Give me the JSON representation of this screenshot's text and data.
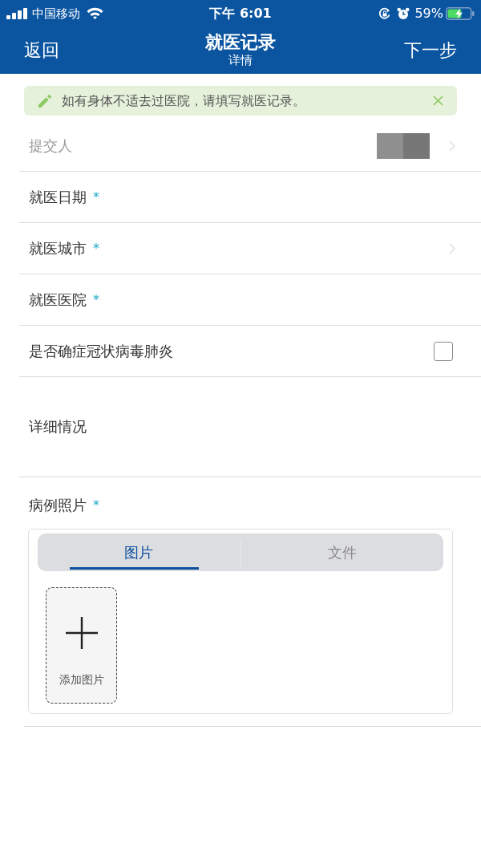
{
  "status_bar": {
    "carrier": "中国移动",
    "time": "下午 6:01",
    "battery_percent": "59%"
  },
  "nav_bar": {
    "back": "返回",
    "title": "就医记录",
    "subtitle": "详情",
    "next": "下一步"
  },
  "notice": {
    "text": "如有身体不适去过医院，请填写就医记录。"
  },
  "form": {
    "fields": [
      {
        "kind": "select",
        "label": "提交人",
        "disabled": true,
        "value_redacted": true
      },
      {
        "kind": "input",
        "label": "就医日期",
        "mark": "*",
        "disabled": false
      },
      {
        "kind": "select",
        "label": "就医城市",
        "mark": "*",
        "disabled": false
      },
      {
        "kind": "input",
        "label": "就医医院",
        "mark": "*",
        "disabled": false
      },
      {
        "kind": "checkbox",
        "label": "是否确症冠状病毒肺炎",
        "disabled": false,
        "checked": false
      },
      {
        "kind": "textarea",
        "label": "详细情况",
        "disabled": false
      }
    ]
  },
  "attachments": {
    "label": "病例照片",
    "mark": "*",
    "tabs": [
      {
        "label": "图片",
        "selected": true
      },
      {
        "label": "文件",
        "selected": false
      }
    ],
    "add_button": "添加图片"
  }
}
